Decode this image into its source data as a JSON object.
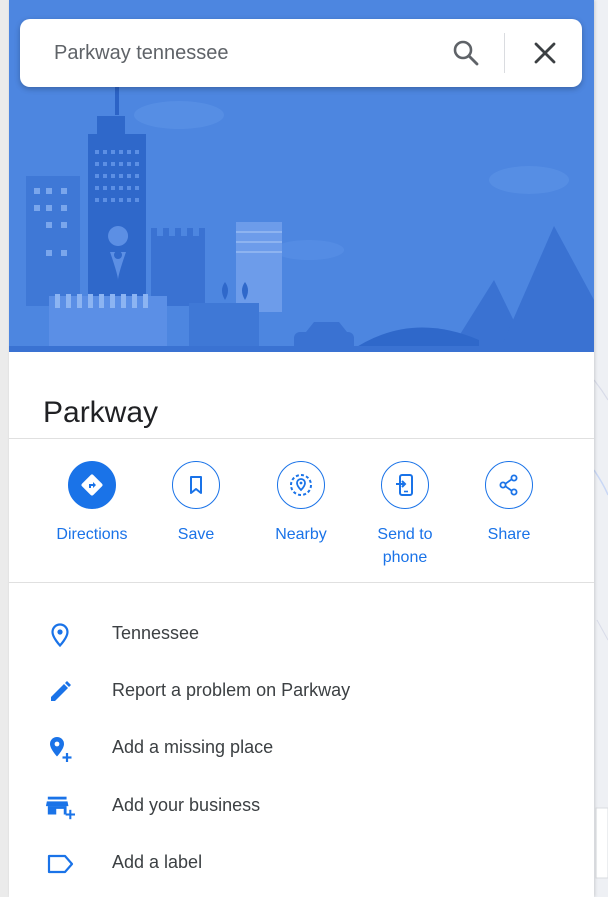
{
  "search": {
    "value": "Parkway tennessee"
  },
  "place": {
    "title": "Parkway"
  },
  "actions": [
    {
      "label": "Directions"
    },
    {
      "label": "Save"
    },
    {
      "label": "Nearby"
    },
    {
      "label": "Send to phone"
    },
    {
      "label": "Share"
    }
  ],
  "info": {
    "location": "Tennessee",
    "report": "Report a problem on Parkway",
    "add_place": "Add a missing place",
    "add_business": "Add your business",
    "add_label": "Add a label"
  },
  "icons": {
    "search": "search-icon",
    "close": "close-icon",
    "directions": "directions-icon",
    "save": "bookmark-icon",
    "nearby": "nearby-icon",
    "send": "phone-icon",
    "share": "share-icon",
    "location": "location-pin-icon",
    "report": "pencil-icon",
    "add_place": "add-location-icon",
    "add_business": "add-business-icon",
    "add_label": "label-icon"
  },
  "colors": {
    "accent": "#1a73e8",
    "hero_bg": "#4d86e0",
    "text": "#202124"
  }
}
